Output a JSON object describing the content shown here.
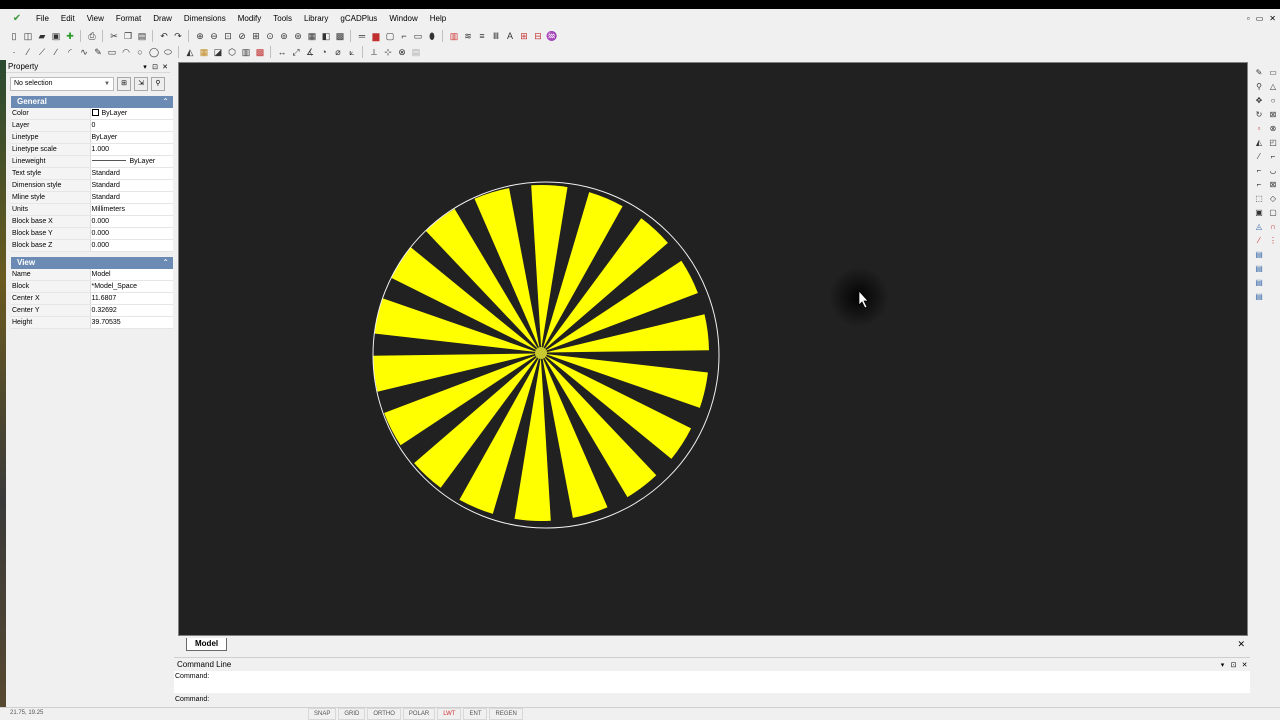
{
  "menubar": {
    "items": [
      "File",
      "Edit",
      "View",
      "Format",
      "Draw",
      "Dimensions",
      "Modify",
      "Tools",
      "Library",
      "gCADPlus",
      "Window",
      "Help"
    ]
  },
  "property_panel": {
    "title": "Property",
    "selection": "No selection",
    "general": {
      "title": "General",
      "rows": [
        {
          "key": "Color",
          "value": "ByLayer"
        },
        {
          "key": "Layer",
          "value": "0"
        },
        {
          "key": "Linetype",
          "value": "ByLayer"
        },
        {
          "key": "Linetype scale",
          "value": "1.000"
        },
        {
          "key": "Lineweight",
          "value": "ByLayer"
        },
        {
          "key": "Text style",
          "value": "Standard"
        },
        {
          "key": "Dimension style",
          "value": "Standard"
        },
        {
          "key": "Mline style",
          "value": "Standard"
        },
        {
          "key": "Units",
          "value": "Millimeters"
        },
        {
          "key": "Block base X",
          "value": "0.000"
        },
        {
          "key": "Block base Y",
          "value": "0.000"
        },
        {
          "key": "Block base Z",
          "value": "0.000"
        }
      ]
    },
    "view": {
      "title": "View",
      "rows": [
        {
          "key": "Name",
          "value": "Model"
        },
        {
          "key": "Block",
          "value": "*Model_Space"
        },
        {
          "key": "Center X",
          "value": "11.6807"
        },
        {
          "key": "Center Y",
          "value": "0.32692"
        },
        {
          "key": "Height",
          "value": "39.70535"
        }
      ]
    }
  },
  "drawing": {
    "background": "#212121",
    "fan_color": "#ffff00",
    "circle_color": "#f0f0f0",
    "blade_count": 18
  },
  "tabs": {
    "model": "Model"
  },
  "command_line": {
    "title": "Command Line",
    "history": "Command:",
    "prompt": "Command:"
  },
  "status": {
    "coords": "21.75, 19.25",
    "buttons": [
      "SNAP",
      "GRID",
      "ORTHO",
      "POLAR",
      "LWT",
      "ENT",
      "REGEN"
    ]
  }
}
